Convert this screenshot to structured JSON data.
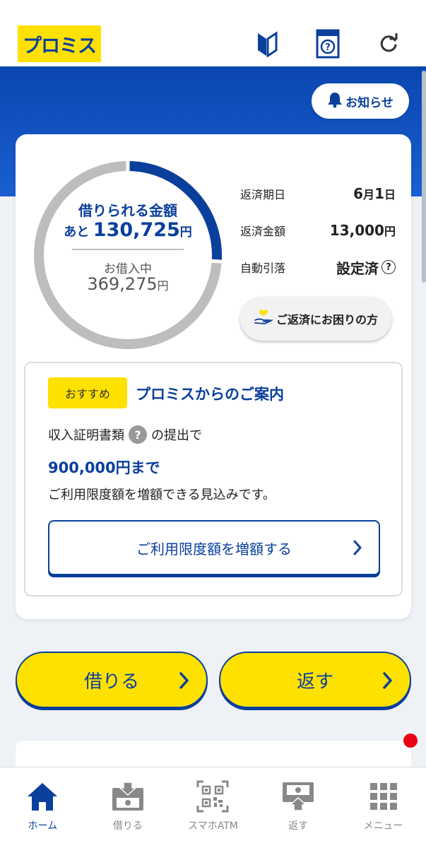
{
  "header": {
    "logo_text": "プロミス",
    "icons": [
      "beginner-mark-icon",
      "help-book-icon",
      "refresh-icon"
    ]
  },
  "notice": {
    "label": "お知らせ"
  },
  "limit": {
    "available_label": "借りられる金額",
    "available_prefix": "あと",
    "available_amount": "130,725",
    "available_yen": "円",
    "borrowed_label": "お借入中",
    "borrowed_amount": "369,275",
    "borrowed_yen": "円",
    "available_fraction": 0.261
  },
  "repayment": {
    "due_date_label": "返済期日",
    "due_month": "6",
    "due_month_unit": "月",
    "due_day": "1",
    "due_day_unit": "日",
    "amount_label": "返済金額",
    "amount_value": "13,000",
    "amount_yen": "円",
    "auto_debit_label": "自動引落",
    "auto_debit_value": "設定済",
    "help_mark": "?",
    "trouble_button": "ご返済にお困りの方"
  },
  "recommend": {
    "badge": "おすすめ",
    "title": "プロミスからのご案内",
    "line1_a": "収入証明書類",
    "line1_b": "の提出で",
    "help_mark": "?",
    "amount": "900,000円まで",
    "line3": "ご利用限度額を増額できる見込みです。",
    "button": "ご利用限度額を増額する"
  },
  "actions": {
    "borrow": "借りる",
    "repay": "返す"
  },
  "nav": {
    "items": [
      {
        "label": "ホーム",
        "icon": "home-icon",
        "active": true
      },
      {
        "label": "借りる",
        "icon": "borrow-icon",
        "active": false
      },
      {
        "label": "スマホATM",
        "icon": "qr-code-icon",
        "active": false
      },
      {
        "label": "返す",
        "icon": "repay-icon",
        "active": false
      },
      {
        "label": "メニュー",
        "icon": "menu-grid-icon",
        "active": false
      }
    ]
  },
  "colors": {
    "brand_blue": "#0a3f9c",
    "brand_yellow": "#ffe100",
    "ring_gray": "#bdbdbd",
    "notification_red": "#e60012"
  }
}
